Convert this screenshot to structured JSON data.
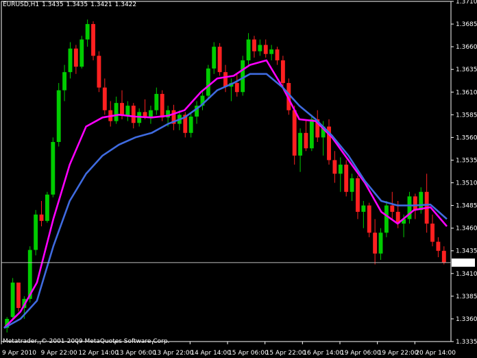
{
  "header": {
    "symbol": "EURUSD,H1",
    "open": "1.3435",
    "high": "1.3435",
    "low": "1.3421",
    "close": "1.3422"
  },
  "copyright": "Metatrader, © 2001-2009 MetaQuotes Software Corp.",
  "colors": {
    "background": "#000000",
    "bull": "#00cc00",
    "bear": "#ff2020",
    "ma_fast": "#ff00ff",
    "ma_slow": "#3f6be0",
    "axis": "#ffffff",
    "price_line": "#c0c0c0"
  },
  "chart_data": {
    "type": "line",
    "ylim": [
      1.3335,
      1.371
    ],
    "y_ticks": [
      "1.3710",
      "1.3685",
      "1.3660",
      "1.3635",
      "1.3610",
      "1.3585",
      "1.3560",
      "1.3535",
      "1.3510",
      "1.3485",
      "1.3460",
      "1.3435",
      "1.3410",
      "1.3385",
      "1.3360",
      "1.3335"
    ],
    "x_ticks": [
      "9 Apr 2010",
      "9 Apr 22:00",
      "12 Apr 14:00",
      "13 Apr 06:00",
      "13 Apr 22:00",
      "14 Apr 14:00",
      "15 Apr 06:00",
      "15 Apr 22:00",
      "16 Apr 14:00",
      "19 Apr 06:00",
      "19 Apr 22:00",
      "20 Apr 14:00"
    ],
    "current_price": "1.3422",
    "series": [
      {
        "name": "",
        "values": [
          1.335,
          1.3368,
          1.34,
          1.347,
          1.353,
          1.3572,
          1.3582,
          1.3585,
          1.3583,
          1.3582,
          1.3584,
          1.359,
          1.361,
          1.3625,
          1.3628,
          1.364,
          1.3645,
          1.3615,
          1.358,
          1.3578,
          1.356,
          1.3535,
          1.351,
          1.3478,
          1.3465,
          1.348,
          1.3483,
          1.3462
        ]
      },
      {
        "name": "",
        "values": [
          1.335,
          1.336,
          1.338,
          1.344,
          1.349,
          1.352,
          1.354,
          1.3552,
          1.356,
          1.3565,
          1.3575,
          1.3582,
          1.3595,
          1.3612,
          1.362,
          1.363,
          1.363,
          1.3615,
          1.3595,
          1.358,
          1.3562,
          1.354,
          1.3512,
          1.349,
          1.3485,
          1.3485,
          1.3486,
          1.347
        ]
      }
    ],
    "candles": [
      [
        1.335,
        1.3362,
        1.3345,
        1.336
      ],
      [
        1.3362,
        1.3405,
        1.3358,
        1.34
      ],
      [
        1.34,
        1.3398,
        1.3368,
        1.3372
      ],
      [
        1.3372,
        1.3385,
        1.336,
        1.3382
      ],
      [
        1.3382,
        1.344,
        1.3378,
        1.3436
      ],
      [
        1.3436,
        1.348,
        1.343,
        1.3475
      ],
      [
        1.3475,
        1.349,
        1.3462,
        1.3468
      ],
      [
        1.3468,
        1.35,
        1.3466,
        1.3497
      ],
      [
        1.3497,
        1.356,
        1.3494,
        1.3555
      ],
      [
        1.3555,
        1.362,
        1.355,
        1.3612
      ],
      [
        1.3612,
        1.364,
        1.36,
        1.3632
      ],
      [
        1.3632,
        1.3665,
        1.3625,
        1.3658
      ],
      [
        1.3658,
        1.3662,
        1.363,
        1.3638
      ],
      [
        1.3638,
        1.3672,
        1.3636,
        1.3668
      ],
      [
        1.3668,
        1.369,
        1.366,
        1.3685
      ],
      [
        1.3685,
        1.3688,
        1.3645,
        1.365
      ],
      [
        1.365,
        1.3655,
        1.361,
        1.3615
      ],
      [
        1.3615,
        1.3625,
        1.3585,
        1.359
      ],
      [
        1.359,
        1.36,
        1.3572,
        1.3578
      ],
      [
        1.3578,
        1.3605,
        1.3575,
        1.3598
      ],
      [
        1.3598,
        1.3612,
        1.358,
        1.3584
      ],
      [
        1.3584,
        1.36,
        1.3578,
        1.3595
      ],
      [
        1.3595,
        1.3598,
        1.357,
        1.3576
      ],
      [
        1.3576,
        1.3592,
        1.3572,
        1.3588
      ],
      [
        1.3588,
        1.3602,
        1.358,
        1.3583
      ],
      [
        1.3583,
        1.3595,
        1.3575,
        1.359
      ],
      [
        1.359,
        1.3615,
        1.3585,
        1.3608
      ],
      [
        1.3608,
        1.3612,
        1.3578,
        1.3582
      ],
      [
        1.3582,
        1.3595,
        1.3572,
        1.359
      ],
      [
        1.359,
        1.3596,
        1.3568,
        1.3575
      ],
      [
        1.3575,
        1.359,
        1.3568,
        1.3585
      ],
      [
        1.3585,
        1.3588,
        1.356,
        1.3565
      ],
      [
        1.3565,
        1.3588,
        1.356,
        1.3583
      ],
      [
        1.3583,
        1.36,
        1.3575,
        1.3595
      ],
      [
        1.3595,
        1.3612,
        1.359,
        1.3606
      ],
      [
        1.3606,
        1.364,
        1.3602,
        1.3636
      ],
      [
        1.3636,
        1.3665,
        1.363,
        1.366
      ],
      [
        1.366,
        1.3664,
        1.3628,
        1.3632
      ],
      [
        1.3632,
        1.364,
        1.361,
        1.3616
      ],
      [
        1.3616,
        1.3625,
        1.36,
        1.362
      ],
      [
        1.362,
        1.363,
        1.3605,
        1.361
      ],
      [
        1.361,
        1.365,
        1.3606,
        1.3645
      ],
      [
        1.3645,
        1.3675,
        1.364,
        1.3668
      ],
      [
        1.3668,
        1.3672,
        1.3648,
        1.3655
      ],
      [
        1.3655,
        1.3668,
        1.365,
        1.3662
      ],
      [
        1.3662,
        1.3668,
        1.3648,
        1.3652
      ],
      [
        1.3652,
        1.3662,
        1.3645,
        1.3657
      ],
      [
        1.3657,
        1.366,
        1.364,
        1.3645
      ],
      [
        1.3645,
        1.365,
        1.3615,
        1.362
      ],
      [
        1.362,
        1.3625,
        1.3585,
        1.359
      ],
      [
        1.359,
        1.3595,
        1.353,
        1.354
      ],
      [
        1.354,
        1.357,
        1.3522,
        1.3565
      ],
      [
        1.3565,
        1.358,
        1.3545,
        1.3548
      ],
      [
        1.3548,
        1.3585,
        1.3545,
        1.358
      ],
      [
        1.358,
        1.359,
        1.3555,
        1.356
      ],
      [
        1.356,
        1.3578,
        1.354,
        1.3572
      ],
      [
        1.3572,
        1.358,
        1.353,
        1.3535
      ],
      [
        1.3535,
        1.3545,
        1.351,
        1.352
      ],
      [
        1.352,
        1.3538,
        1.35,
        1.353
      ],
      [
        1.353,
        1.3535,
        1.3495,
        1.35
      ],
      [
        1.35,
        1.352,
        1.349,
        1.3515
      ],
      [
        1.3515,
        1.3518,
        1.347,
        1.3478
      ],
      [
        1.3478,
        1.349,
        1.346,
        1.3485
      ],
      [
        1.3485,
        1.3488,
        1.345,
        1.3455
      ],
      [
        1.3455,
        1.347,
        1.342,
        1.3432
      ],
      [
        1.3432,
        1.346,
        1.3425,
        1.3455
      ],
      [
        1.3455,
        1.349,
        1.345,
        1.3485
      ],
      [
        1.3485,
        1.35,
        1.347,
        1.3478
      ],
      [
        1.3478,
        1.349,
        1.346,
        1.3465
      ],
      [
        1.3465,
        1.3475,
        1.345,
        1.347
      ],
      [
        1.347,
        1.35,
        1.3465,
        1.3495
      ],
      [
        1.3495,
        1.3498,
        1.347,
        1.348
      ],
      [
        1.348,
        1.3505,
        1.3476,
        1.35
      ],
      [
        1.35,
        1.352,
        1.3455,
        1.3465
      ],
      [
        1.3465,
        1.3475,
        1.344,
        1.3445
      ],
      [
        1.3445,
        1.345,
        1.3428,
        1.3435
      ],
      [
        1.3435,
        1.344,
        1.342,
        1.3422
      ]
    ]
  }
}
